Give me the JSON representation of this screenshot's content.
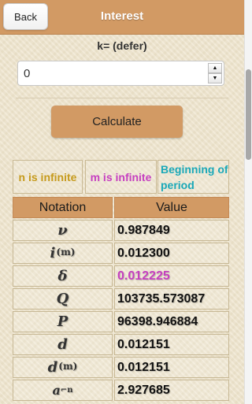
{
  "header": {
    "title": "Interest",
    "back_label": "Back"
  },
  "k_field": {
    "label": "k= (defer)",
    "value": "0"
  },
  "calculate_label": "Calculate",
  "options": [
    "n is infinite",
    "m is infinite",
    "Beginning of period"
  ],
  "table": {
    "headers": [
      "Notation",
      "Value"
    ],
    "rows": [
      {
        "symbol": "ν",
        "value": "0.987849"
      },
      {
        "symbol": "i(m)",
        "value": "0.012300"
      },
      {
        "symbol": "δ",
        "value": "0.012225",
        "highlight": true
      },
      {
        "symbol": "Q",
        "value": "103735.573087"
      },
      {
        "symbol": "P",
        "value": "96398.946884"
      },
      {
        "symbol": "d",
        "value": "0.012151"
      },
      {
        "symbol": "d(m)",
        "value": "0.012151"
      },
      {
        "symbol": "a n|",
        "value": "2.927685"
      }
    ]
  },
  "colors": {
    "header": "#d29a64",
    "option_n": "#c69a1c",
    "option_m": "#c63fc0",
    "option_begin": "#1aa8b8",
    "highlight": "#c63fc0"
  }
}
